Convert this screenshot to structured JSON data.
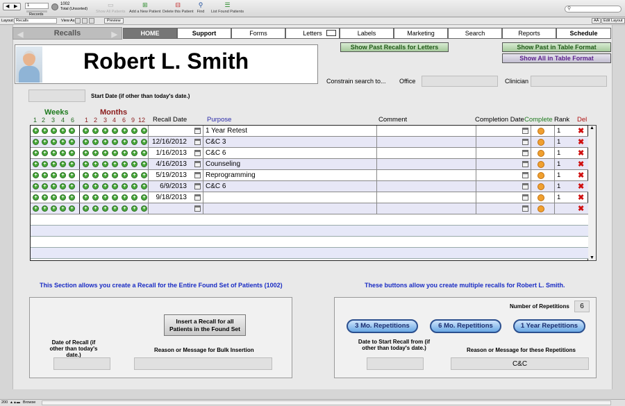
{
  "toolbar": {
    "record_number": "1",
    "records_label": "Records",
    "total_count": "1002",
    "total_label": "Total (Unsorted)",
    "show_all": "Show All Patients",
    "add_new": "Add a New Patient",
    "delete": "Delete this Patient",
    "find": "Find",
    "list_found": "List Found Patients"
  },
  "layoutbar": {
    "layout_label": "Layout:",
    "layout_value": "Recalls",
    "view_as": "View As:",
    "preview": "Preview",
    "aa": "AÄ",
    "edit_layout": "Edit Layout"
  },
  "nav": {
    "section": "Recalls",
    "tabs": [
      "HOME",
      "Support",
      "Forms",
      "Letters",
      "Labels",
      "Marketing",
      "Search",
      "Reports",
      "Schedule"
    ]
  },
  "patient": {
    "name": "Robert L. Smith"
  },
  "buttons": {
    "show_past_letters": "Show Past Recalls for Letters",
    "show_past_table": "Show Past in Table Format",
    "show_all_table": "Show All in Table Format"
  },
  "constrain": {
    "label": "Constrain search  to...",
    "office": "Office",
    "clinician": "Clinician"
  },
  "start_date": {
    "label": "Start Date (if other than today's date.)"
  },
  "table": {
    "weeks_label": "Weeks",
    "weeks": [
      "1",
      "2",
      "3",
      "4",
      "6"
    ],
    "months_label": "Months",
    "months": [
      "1",
      "2",
      "3",
      "4",
      "6",
      "9",
      "12"
    ],
    "headers": {
      "recall_date": "Recall Date",
      "purpose": "Purpose",
      "comment": "Comment",
      "completion_date": "Completion Date",
      "complete": "Complete",
      "rank": "Rank",
      "del": "Del"
    },
    "rows": [
      {
        "date": "",
        "purpose": "1 Year Retest",
        "rank": "1"
      },
      {
        "date": "12/16/2012",
        "purpose": "C&C 3",
        "rank": "1"
      },
      {
        "date": "1/16/2013",
        "purpose": "C&C 6",
        "rank": "1"
      },
      {
        "date": "4/16/2013",
        "purpose": "Counseling",
        "rank": "1"
      },
      {
        "date": "5/19/2013",
        "purpose": "Reprogramming",
        "rank": "1"
      },
      {
        "date": "6/9/2013",
        "purpose": "C&C 6",
        "rank": "1"
      },
      {
        "date": "9/18/2013",
        "purpose": "",
        "rank": "1"
      },
      {
        "date": "",
        "purpose": "",
        "rank": ""
      }
    ]
  },
  "bulk": {
    "heading": "This Section allows you create a Recall for the Entire Found Set of Patients (1002)",
    "insert_button": "Insert a Recall for all Patients in the Found Set",
    "date_label": "Date of Recall (if other than today's date.)",
    "reason_label": "Reason or Message for Bulk Insertion"
  },
  "repetitions": {
    "heading": "These buttons allow you create multiple recalls for Robert L. Smith.",
    "count_label": "Number of Repetitions",
    "count": "6",
    "btn3": "3 Mo. Repetitions",
    "btn6": "6 Mo. Repetitions",
    "btn12": "1 Year Repetitions",
    "start_label": "Date to Start Recall from (if other than today's date.)",
    "reason_label": "Reason or Message for these Repetitions",
    "reason_value": "C&C"
  },
  "status": {
    "zoom": "200",
    "mode": "Browse"
  }
}
